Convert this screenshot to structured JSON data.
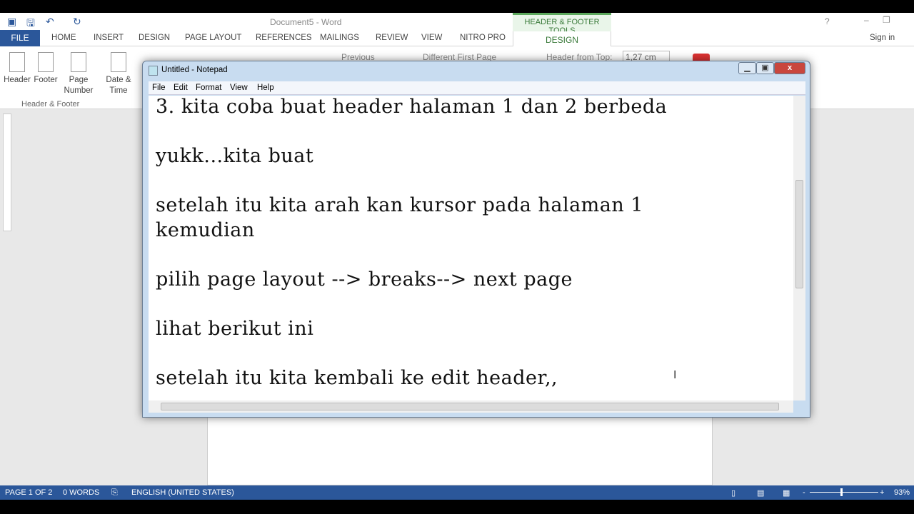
{
  "word": {
    "title": "Document5 - Word",
    "tabs": [
      "FILE",
      "HOME",
      "INSERT",
      "DESIGN",
      "PAGE LAYOUT",
      "REFERENCES",
      "MAILINGS",
      "REVIEW",
      "VIEW",
      "NITRO PRO"
    ],
    "context_group": "HEADER & FOOTER TOOLS",
    "context_tab": "DESIGN",
    "sign_in": "Sign in",
    "ribbon": {
      "header": "Header",
      "footer": "Footer",
      "page_number": "Page Number",
      "date_time": "Date & Time",
      "group_label": "Header & Footer",
      "previous": "Previous",
      "different_first_page": "Different First Page",
      "header_from_top": "Header from Top:",
      "header_from_top_value": "1,27 cm"
    },
    "status": {
      "page": "PAGE 1 OF 2",
      "words": "0 WORDS",
      "language": "ENGLISH (UNITED STATES)",
      "zoom": "93%",
      "zoom_level": 93
    }
  },
  "notepad": {
    "title": "Untitled - Notepad",
    "menu": [
      "File",
      "Edit",
      "Format",
      "View",
      "Help"
    ],
    "lines": [
      "3. kita coba buat header halaman 1 dan 2 berbeda",
      "",
      "yukk...kita buat",
      "",
      "setelah itu kita arah kan kursor pada halaman 1",
      "kemudian",
      "",
      "pilih page layout --> breaks--> next page",
      "",
      "lihat berikut ini",
      "",
      "setelah itu kita kembali ke edit header,,"
    ]
  }
}
